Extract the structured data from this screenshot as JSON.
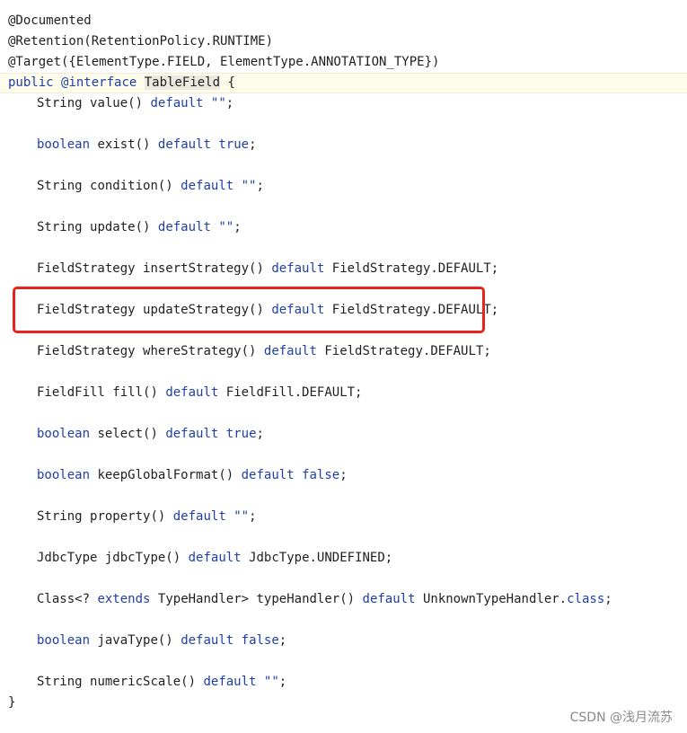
{
  "editor": {
    "header": {
      "l1": "@Documented",
      "l2": "@Retention(RetentionPolicy.RUNTIME)",
      "l3": "@Target({ElementType.FIELD, ElementType.ANNOTATION_TYPE})",
      "l4": {
        "public": "public",
        "interface": "@interface",
        "name": "TableField",
        "brace": "{"
      }
    },
    "members": {
      "value": {
        "type": "String",
        "method": "value()",
        "default": "default",
        "value": "\"\"",
        "end": ";"
      },
      "exist": {
        "type": "boolean",
        "method": "exist()",
        "default": "default",
        "value": "true",
        "end": ";"
      },
      "condition": {
        "type": "String",
        "method": "condition()",
        "default": "default",
        "value": "\"\"",
        "end": ";"
      },
      "update": {
        "type": "String",
        "method": "update()",
        "default": "default",
        "value": "\"\"",
        "end": ";"
      },
      "insertStrategy": {
        "type": "FieldStrategy",
        "method": "insertStrategy()",
        "default": "default",
        "value": "FieldStrategy.DEFAULT;"
      },
      "updateStrategy": {
        "type": "FieldStrategy",
        "method": "updateStrategy()",
        "default": "default",
        "value": "FieldStrategy.DEFAULT;"
      },
      "whereStrategy": {
        "type": "FieldStrategy",
        "method": "whereStrategy()",
        "default": "default",
        "value": "FieldStrategy.DEFAULT;"
      },
      "fill": {
        "type": "FieldFill",
        "method": "fill()",
        "default": "default",
        "value": "FieldFill.DEFAULT;"
      },
      "select": {
        "type": "boolean",
        "method": "select()",
        "default": "default",
        "value": "true",
        "end": ";"
      },
      "keepGlobalFormat": {
        "type": "boolean",
        "method": "keepGlobalFormat()",
        "default": "default",
        "value": "false",
        "end": ";"
      },
      "property": {
        "type": "String",
        "method": "property()",
        "default": "default",
        "value": "\"\"",
        "end": ";"
      },
      "jdbcType": {
        "type": "JdbcType",
        "method": "jdbcType()",
        "default": "default",
        "value": "JdbcType.UNDEFINED;"
      },
      "typeHandler": {
        "prefix": "Class<?",
        "extends": "extends",
        "bound": "TypeHandler>",
        "method": "typeHandler()",
        "default": "default",
        "value": "UnknownTypeHandler.",
        "cls": "class",
        "end": ";"
      },
      "javaType": {
        "type": "boolean",
        "method": "javaType()",
        "default": "default",
        "value": "false",
        "end": ";"
      },
      "numericScale": {
        "type": "String",
        "method": "numericScale()",
        "default": "default",
        "value": "\"\"",
        "end": ";"
      }
    },
    "closing_brace": "}"
  },
  "colors": {
    "keyword": "#1e3fa8",
    "text": "#1f1f1f",
    "highlight_border": "#e8231a",
    "current_line_bg": "#fdfbe9"
  },
  "watermark": "CSDN @浅月流苏"
}
